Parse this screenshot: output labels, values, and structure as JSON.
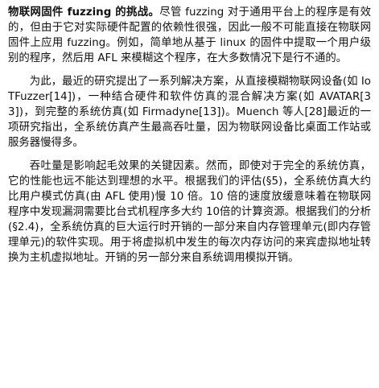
{
  "paragraphs": [
    {
      "lead": "物联网固件 fuzzing 的挑战。",
      "text": "尽管 fuzzing 对于通用平台上的程序是有效的，但由于它对实际硬件配置的依赖性很强，因此一般不可能直接在物联网固件上应用 fuzzing。例如，简单地从基于 linux 的固件中提取一个用户级别的程序，然后用 AFL 来模糊这个程序，在大多数情况下是行不通的。"
    },
    {
      "lead": "",
      "text": "为此，最近的研究提出了一系列解决方案，从直接模糊物联网设备(如 IoTFuzzer[14])，一种结合硬件和软件仿真的混合解决方案(如 AVATAR[33])，到完整的系统仿真(如 Firmadyne[13])。Muench 等人[28]最近的一项研究指出，全系统仿真产生最高吞吐量，因为物联网设备比桌面工作站或服务器慢得多。"
    },
    {
      "lead": "",
      "text": "吞吐量是影响起毛效果的关键因素。然而，即使对于完全的系统仿真，它的性能也远不能达到理想的水平。根据我们的评估(§5)，全系统仿真大约比用户模式仿真(由 AFL 使用)慢 10 倍。10 倍的速度放缓意味着在物联网程序中发现漏洞需要比台式机程序多大约 10倍的计算资源。根据我们的分析(§2.4)，全系统仿真的巨大运行时开销的一部分来自内存管理单元(即内存管理单元)的软件实现。用于将虚拟机中发生的每次内存访问的来宾虚拟地址转换为主机虚拟地址。开销的另一部分来自系统调用模拟开销。"
    }
  ]
}
